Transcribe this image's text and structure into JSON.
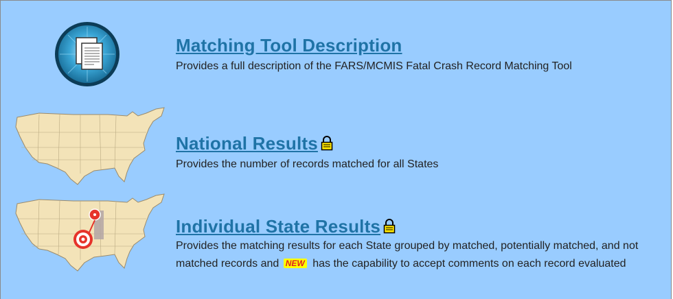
{
  "sections": [
    {
      "title": "Matching Tool Description",
      "description": "Provides a full description of the FARS/MCMIS Fatal Crash Record Matching Tool",
      "icon": "documents-icon"
    },
    {
      "title": "National Results",
      "description": "Provides the number of records matched for all States",
      "icon": "us-map-icon",
      "locked": true
    },
    {
      "title": "Individual State Results",
      "description_part1": "Provides the matching results for each State grouped by matched, potentially matched, and not matched records and",
      "new_badge": "NEW",
      "description_part2": "has the capability to accept comments on each record evaluated",
      "icon": "us-map-target-icon",
      "locked": true
    }
  ],
  "colors": {
    "background": "#99ccff",
    "link": "#1f73a6",
    "badge_bg": "#ffff00",
    "badge_text": "#e02020"
  }
}
